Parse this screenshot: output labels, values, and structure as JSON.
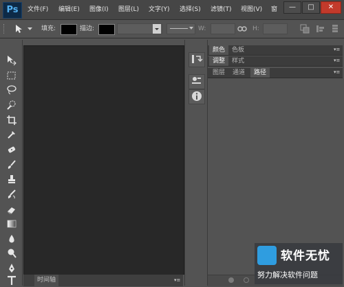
{
  "app": {
    "logo": "Ps"
  },
  "menubar": {
    "items": [
      "文件(F)",
      "编辑(E)",
      "图像(I)",
      "图层(L)",
      "文字(Y)",
      "选择(S)",
      "滤镜(T)",
      "视图(V)",
      "窗"
    ],
    "window_buttons": {
      "minimize": "—",
      "maximize": "□",
      "close": "✕"
    }
  },
  "options_bar": {
    "fill_label": "填充:",
    "stroke_label": "描边:",
    "width_label": "W:",
    "height_label": "H:",
    "fill_color": "#000000",
    "stroke_color": "#000000"
  },
  "toolbar": {
    "tools": [
      "move-tool",
      "marquee-tool",
      "lasso-tool",
      "quick-selection-tool",
      "crop-tool",
      "eyedropper-tool",
      "spot-healing-tool",
      "brush-tool",
      "clone-stamp-tool",
      "history-brush-tool",
      "eraser-tool",
      "gradient-tool",
      "blur-tool",
      "dodge-tool",
      "pen-tool",
      "type-tool"
    ]
  },
  "timeline": {
    "tab_label": "时间轴"
  },
  "panels": {
    "group1": {
      "tabs": [
        "颜色",
        "色板"
      ],
      "active": 0
    },
    "group2": {
      "tabs": [
        "调整",
        "样式"
      ],
      "active": 0
    },
    "group3": {
      "tabs": [
        "图层",
        "通道",
        "路径"
      ],
      "active": 2
    }
  },
  "watermark": {
    "title": "软件无忧",
    "subtitle": "努力解决软件问题"
  },
  "colors": {
    "accent": "#2f9de0",
    "canvas": "#282828",
    "panel": "#535353"
  }
}
